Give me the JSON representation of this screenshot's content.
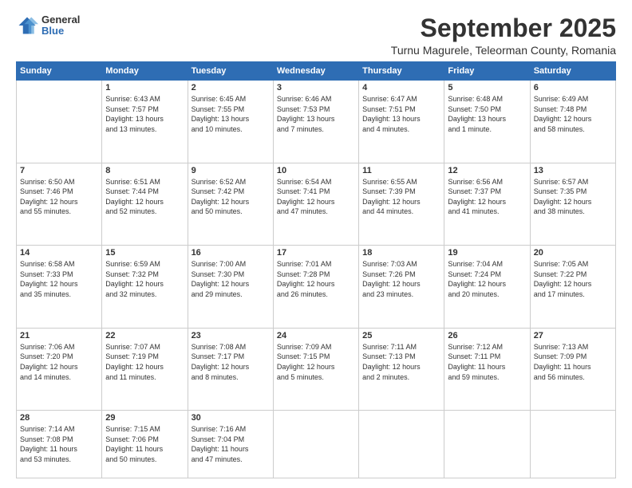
{
  "logo": {
    "general": "General",
    "blue": "Blue"
  },
  "title": "September 2025",
  "location": "Turnu Magurele, Teleorman County, Romania",
  "weekdays": [
    "Sunday",
    "Monday",
    "Tuesday",
    "Wednesday",
    "Thursday",
    "Friday",
    "Saturday"
  ],
  "weeks": [
    [
      {
        "day": "",
        "info": ""
      },
      {
        "day": "1",
        "info": "Sunrise: 6:43 AM\nSunset: 7:57 PM\nDaylight: 13 hours\nand 13 minutes."
      },
      {
        "day": "2",
        "info": "Sunrise: 6:45 AM\nSunset: 7:55 PM\nDaylight: 13 hours\nand 10 minutes."
      },
      {
        "day": "3",
        "info": "Sunrise: 6:46 AM\nSunset: 7:53 PM\nDaylight: 13 hours\nand 7 minutes."
      },
      {
        "day": "4",
        "info": "Sunrise: 6:47 AM\nSunset: 7:51 PM\nDaylight: 13 hours\nand 4 minutes."
      },
      {
        "day": "5",
        "info": "Sunrise: 6:48 AM\nSunset: 7:50 PM\nDaylight: 13 hours\nand 1 minute."
      },
      {
        "day": "6",
        "info": "Sunrise: 6:49 AM\nSunset: 7:48 PM\nDaylight: 12 hours\nand 58 minutes."
      }
    ],
    [
      {
        "day": "7",
        "info": "Sunrise: 6:50 AM\nSunset: 7:46 PM\nDaylight: 12 hours\nand 55 minutes."
      },
      {
        "day": "8",
        "info": "Sunrise: 6:51 AM\nSunset: 7:44 PM\nDaylight: 12 hours\nand 52 minutes."
      },
      {
        "day": "9",
        "info": "Sunrise: 6:52 AM\nSunset: 7:42 PM\nDaylight: 12 hours\nand 50 minutes."
      },
      {
        "day": "10",
        "info": "Sunrise: 6:54 AM\nSunset: 7:41 PM\nDaylight: 12 hours\nand 47 minutes."
      },
      {
        "day": "11",
        "info": "Sunrise: 6:55 AM\nSunset: 7:39 PM\nDaylight: 12 hours\nand 44 minutes."
      },
      {
        "day": "12",
        "info": "Sunrise: 6:56 AM\nSunset: 7:37 PM\nDaylight: 12 hours\nand 41 minutes."
      },
      {
        "day": "13",
        "info": "Sunrise: 6:57 AM\nSunset: 7:35 PM\nDaylight: 12 hours\nand 38 minutes."
      }
    ],
    [
      {
        "day": "14",
        "info": "Sunrise: 6:58 AM\nSunset: 7:33 PM\nDaylight: 12 hours\nand 35 minutes."
      },
      {
        "day": "15",
        "info": "Sunrise: 6:59 AM\nSunset: 7:32 PM\nDaylight: 12 hours\nand 32 minutes."
      },
      {
        "day": "16",
        "info": "Sunrise: 7:00 AM\nSunset: 7:30 PM\nDaylight: 12 hours\nand 29 minutes."
      },
      {
        "day": "17",
        "info": "Sunrise: 7:01 AM\nSunset: 7:28 PM\nDaylight: 12 hours\nand 26 minutes."
      },
      {
        "day": "18",
        "info": "Sunrise: 7:03 AM\nSunset: 7:26 PM\nDaylight: 12 hours\nand 23 minutes."
      },
      {
        "day": "19",
        "info": "Sunrise: 7:04 AM\nSunset: 7:24 PM\nDaylight: 12 hours\nand 20 minutes."
      },
      {
        "day": "20",
        "info": "Sunrise: 7:05 AM\nSunset: 7:22 PM\nDaylight: 12 hours\nand 17 minutes."
      }
    ],
    [
      {
        "day": "21",
        "info": "Sunrise: 7:06 AM\nSunset: 7:20 PM\nDaylight: 12 hours\nand 14 minutes."
      },
      {
        "day": "22",
        "info": "Sunrise: 7:07 AM\nSunset: 7:19 PM\nDaylight: 12 hours\nand 11 minutes."
      },
      {
        "day": "23",
        "info": "Sunrise: 7:08 AM\nSunset: 7:17 PM\nDaylight: 12 hours\nand 8 minutes."
      },
      {
        "day": "24",
        "info": "Sunrise: 7:09 AM\nSunset: 7:15 PM\nDaylight: 12 hours\nand 5 minutes."
      },
      {
        "day": "25",
        "info": "Sunrise: 7:11 AM\nSunset: 7:13 PM\nDaylight: 12 hours\nand 2 minutes."
      },
      {
        "day": "26",
        "info": "Sunrise: 7:12 AM\nSunset: 7:11 PM\nDaylight: 11 hours\nand 59 minutes."
      },
      {
        "day": "27",
        "info": "Sunrise: 7:13 AM\nSunset: 7:09 PM\nDaylight: 11 hours\nand 56 minutes."
      }
    ],
    [
      {
        "day": "28",
        "info": "Sunrise: 7:14 AM\nSunset: 7:08 PM\nDaylight: 11 hours\nand 53 minutes."
      },
      {
        "day": "29",
        "info": "Sunrise: 7:15 AM\nSunset: 7:06 PM\nDaylight: 11 hours\nand 50 minutes."
      },
      {
        "day": "30",
        "info": "Sunrise: 7:16 AM\nSunset: 7:04 PM\nDaylight: 11 hours\nand 47 minutes."
      },
      {
        "day": "",
        "info": ""
      },
      {
        "day": "",
        "info": ""
      },
      {
        "day": "",
        "info": ""
      },
      {
        "day": "",
        "info": ""
      }
    ]
  ]
}
